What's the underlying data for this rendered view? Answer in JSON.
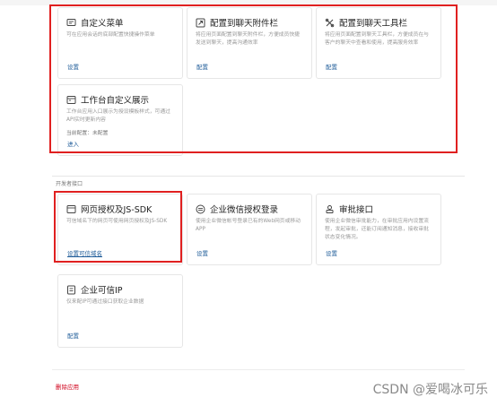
{
  "top_cards": [
    {
      "title": "自定义菜单",
      "desc": "可在应用会话的底部配置快捷操作菜单",
      "link": "设置",
      "icon": "menu-icon"
    },
    {
      "title": "配置到聊天附件栏",
      "desc": "将应用页面配置到聊天附件栏，方便成员快捷发送到聊天，提高沟通效率",
      "link": "配置",
      "icon": "attachment-icon"
    },
    {
      "title": "配置到聊天工具栏",
      "desc": "将应用页面配置到聊天工具栏，方便成员在与客户的聊天中查看和使用，提高服务效率",
      "link": "配置",
      "icon": "toolbar-icon"
    },
    {
      "title": "工作台自定义展示",
      "desc": "工作台应用入口展示为授设模板样式，可通过API实时更新内容",
      "extra": "当前配置：未配置",
      "link": "进入",
      "icon": "dashboard-icon"
    }
  ],
  "section_label": "开发者接口",
  "dev_cards": [
    {
      "title": "网页授权及JS-SDK",
      "desc": "可信域名下的网页可使用网页授权及JS-SDK",
      "link": "设置可信域名",
      "icon": "web-icon"
    },
    {
      "title": "企业微信授权登录",
      "desc": "使用企业微信帐号登录已有的Web网页或移动APP",
      "link": "设置",
      "icon": "login-icon"
    },
    {
      "title": "审批接口",
      "desc": "使用企业微信审批能力，在审批应用内设置流程，发起审批，还能订阅通知消息，接收审批状态变化情况。",
      "link": "设置",
      "icon": "approval-icon"
    },
    {
      "title": "企业可信IP",
      "desc": "仅来配IP可通过接口获取企业数据",
      "link": "配置",
      "icon": "ip-icon"
    }
  ],
  "delete_label": "删除应用",
  "watermark": "CSDN @爱喝冰可乐",
  "colors": {
    "highlight": "#e02020",
    "link": "#1f5c99",
    "danger": "#d0021b"
  }
}
